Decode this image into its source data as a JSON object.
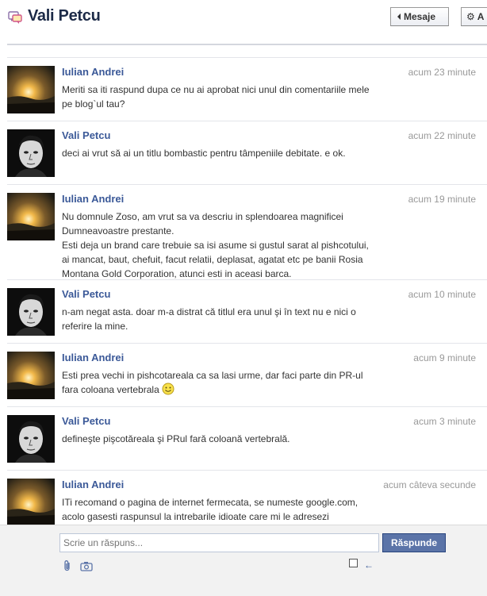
{
  "header": {
    "title": "Vali Petcu",
    "back_button": "Mesaje",
    "actions_button": "A"
  },
  "messages": [
    {
      "author": "Iulian Andrei",
      "time": "acum 23 minute",
      "avatar": "sunset-avatar",
      "lines": [
        "Meriti sa iti raspund dupa ce nu ai aprobat nici unul din comentariile mele",
        "pe blog`ul tau?"
      ]
    },
    {
      "author": "Vali Petcu",
      "time": "acum 22 minute",
      "avatar": "portrait-avatar",
      "lines": [
        "deci ai vrut să ai un titlu bombastic pentru tâmpeniile debitate. e ok."
      ]
    },
    {
      "author": "Iulian Andrei",
      "time": "acum 19 minute",
      "avatar": "sunset-avatar",
      "lines": [
        "Nu domnule Zoso, am vrut sa va descriu in splendoarea magnificei",
        "Dumneavoastre prestante.",
        "Esti deja un brand care trebuie sa isi asume si gustul sarat al pishcotului,",
        "ai mancat, baut, chefuit, facut relatii, deplasat, agatat etc pe banii Rosia",
        "Montana Gold Corporation, atunci esti in aceasi barca."
      ]
    },
    {
      "author": "Vali Petcu",
      "time": "acum 10 minute",
      "avatar": "portrait-avatar",
      "lines": [
        "n-am negat asta. doar m-a distrat că titlul era unul şi în text nu e nici o",
        "referire la mine."
      ]
    },
    {
      "author": "Iulian Andrei",
      "time": "acum 9 minute",
      "avatar": "sunset-avatar",
      "lines": [
        "Esti prea vechi in pishcotareala ca sa lasi urme, dar faci parte din PR-ul",
        "fara coloana vertebrala"
      ],
      "emoji": "smiley-icon"
    },
    {
      "author": "Vali Petcu",
      "time": "acum 3 minute",
      "avatar": "portrait-avatar",
      "lines": [
        "defineşte pişcotăreala şi PRul fară coloană vertebrală."
      ]
    },
    {
      "author": "Iulian Andrei",
      "time": "acum câteva secunde",
      "avatar": "sunset-avatar",
      "lines": [
        "ITi recomand o pagina de internet fermecata, se numeste google.com,",
        "acolo gasesti raspunsul la intrebarile idioate care mi le adresezi"
      ]
    }
  ],
  "composer": {
    "placeholder": "Scrie un răspuns...",
    "send_label": "Răspunde",
    "enter_symbol": "←"
  },
  "colors": {
    "link": "#3b5998",
    "button": "#5b74a8",
    "timestamp": "#999999"
  }
}
